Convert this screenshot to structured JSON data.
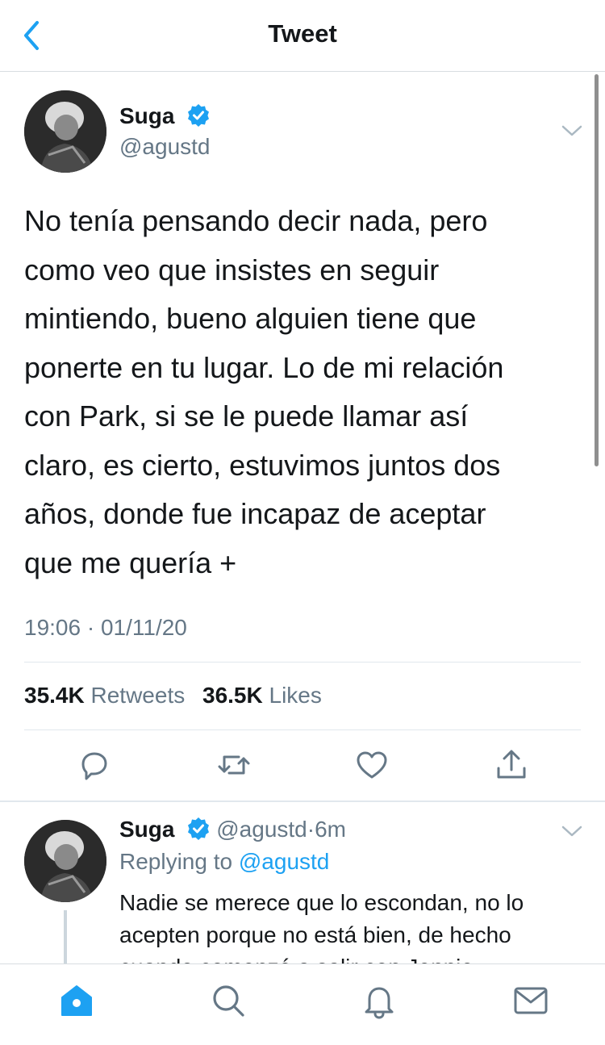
{
  "header": {
    "title": "Tweet"
  },
  "tweet": {
    "author_name": "Suga",
    "author_handle": "@agustd",
    "verified": true,
    "lines": [
      "No tenía pensando decir nada, pero",
      "como veo que insistes en seguir",
      "mintiendo, bueno alguien tiene que",
      "ponerte en tu lugar. Lo de mi relación",
      "con Park, si se le puede llamar así",
      "claro, es cierto, estuvimos juntos dos",
      "años, donde fue incapaz de aceptar",
      "que me quería +"
    ],
    "timestamp": "19:06 · 01/11/20",
    "retweets_count": "35.4K",
    "retweets_label": "Retweets",
    "likes_count": "36.5K",
    "likes_label": "Likes"
  },
  "reply": {
    "author_name": "Suga",
    "author_handle": "@agustd",
    "separator": "·",
    "time_ago": "6m",
    "replying_prefix": "Replying to",
    "replying_to": "@agustd",
    "lines": [
      "Nadie se merece que lo escondan, no lo",
      "acepten porque no está bien, de hecho",
      "cuando comenzó a salir con Jennie"
    ]
  },
  "icons": {
    "back": "chevron-left-icon",
    "more": "chevron-down-icon",
    "reply": "reply-icon",
    "retweet": "retweet-icon",
    "like": "heart-icon",
    "share": "share-icon",
    "home": "home-icon",
    "search": "search-icon",
    "notifications": "bell-icon",
    "messages": "mail-icon"
  },
  "colors": {
    "accent": "#1da1f2",
    "text": "#14171a",
    "secondary": "#657786",
    "divider": "#e1e8ed"
  }
}
